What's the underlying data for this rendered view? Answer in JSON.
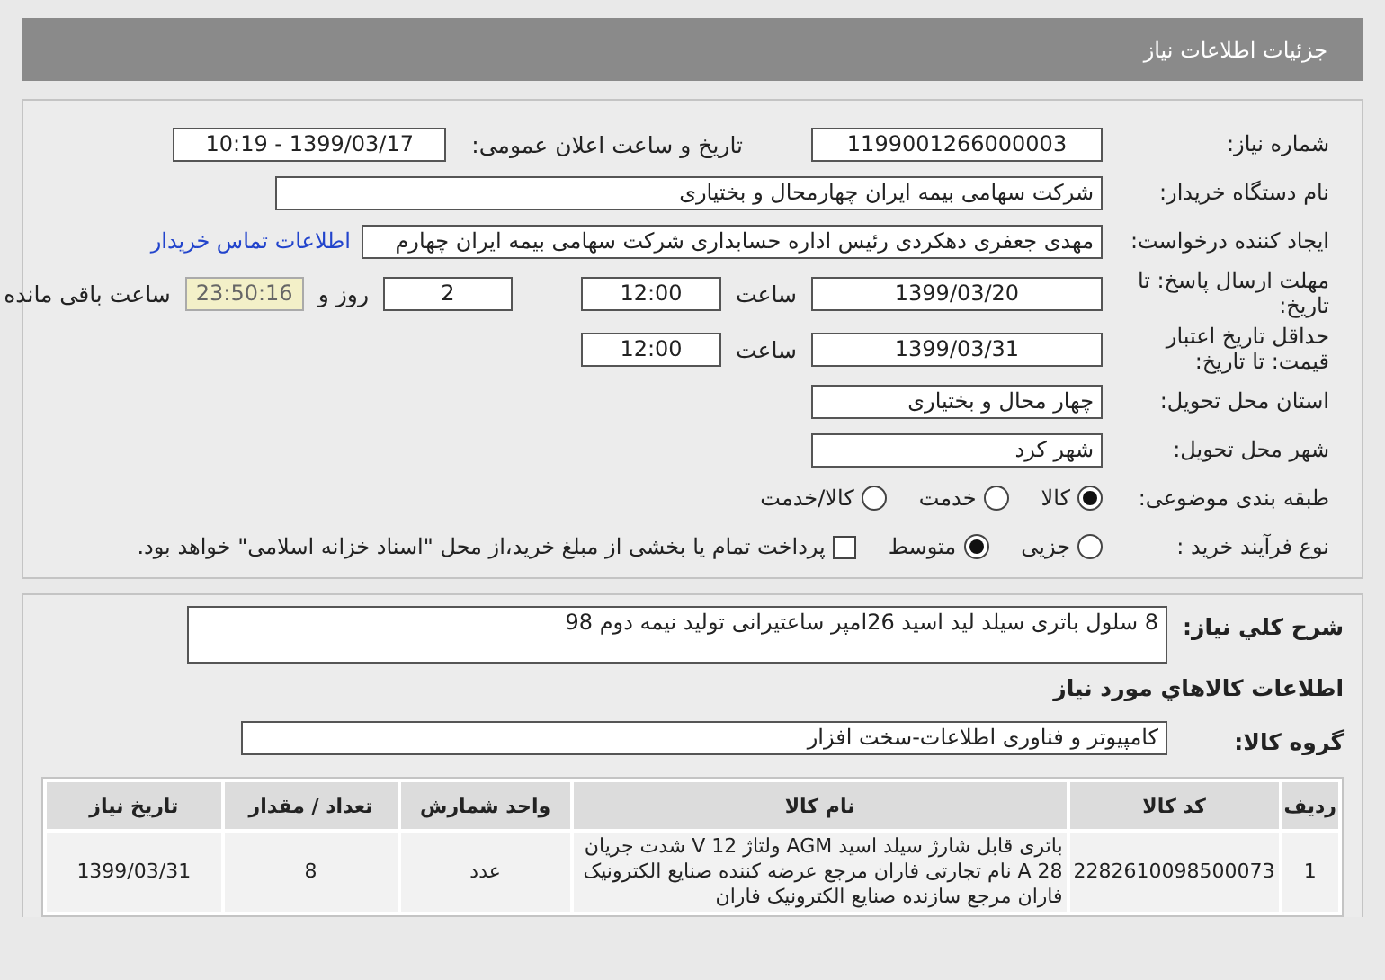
{
  "header": {
    "title": "جزئیات اطلاعات نیاز"
  },
  "need_number": {
    "label": "شماره نیاز:",
    "value": "1199001266000003"
  },
  "announce": {
    "label": "تاریخ و ساعت اعلان عمومی:",
    "value": "1399/03/17 - 10:19"
  },
  "buyer": {
    "label": "نام دستگاه خریدار:",
    "value": "شرکت سهامی بیمه ایران چهارمحال و بختیاری"
  },
  "creator": {
    "label": "ایجاد کننده درخواست:",
    "value": "مهدی جعفری دهکردی رئیس اداره حسابداری شرکت سهامی بیمه ایران چهارم",
    "link": "اطلاعات تماس خریدار"
  },
  "deadline": {
    "label": "مهلت ارسال پاسخ: تا تاریخ:",
    "date": "1399/03/20",
    "time_label": "ساعت",
    "time": "12:00",
    "days": "2",
    "days_label": "روز و",
    "remaining": "23:50:16",
    "remaining_label": "ساعت باقی مانده"
  },
  "validity": {
    "label": "حداقل تاریخ اعتبار قیمت: تا تاریخ:",
    "date": "1399/03/31",
    "time_label": "ساعت",
    "time": "12:00"
  },
  "province": {
    "label": "استان محل تحویل:",
    "value": "چهار محال و بختیاری"
  },
  "city": {
    "label": "شهر محل تحویل:",
    "value": "شهر کرد"
  },
  "category": {
    "label": "طبقه بندی موضوعی:",
    "options": [
      {
        "label": "کالا",
        "selected": true
      },
      {
        "label": "خدمت",
        "selected": false
      },
      {
        "label": "کالا/خدمت",
        "selected": false
      }
    ]
  },
  "process": {
    "label": "نوع فرآیند خرید :",
    "options": [
      {
        "label": "جزیی",
        "selected": false
      },
      {
        "label": "متوسط",
        "selected": true
      }
    ],
    "payment": {
      "label": "پرداخت تمام یا بخشی از مبلغ خرید،از محل \"اسناد خزانه اسلامی\" خواهد بود.",
      "checked": false
    }
  },
  "description": {
    "label": "شرح کلي نياز:",
    "value": "8 سلول باتری سیلد لید اسید 26امپر ساعتیرانی تولید نیمه دوم 98"
  },
  "goods_heading": "اطلاعات کالاهاي مورد نياز",
  "goods_group": {
    "label": "گروه کالا:",
    "value": "کامپیوتر و فناوری اطلاعات-سخت افزار"
  },
  "table": {
    "columns": [
      "ردیف",
      "کد کالا",
      "نام کالا",
      "واحد شمارش",
      "تعداد / مقدار",
      "تاریخ نیاز"
    ],
    "rows": [
      [
        "1",
        "2282610098500073",
        "باتری قابل شارژ سیلد اسید AGM ولتاژ 12 V شدت جریان 28 A نام تجارتی فاران مرجع عرضه کننده صنایع الکترونیک فاران مرجع سازنده صنایع الکترونیک فاران",
        "عدد",
        "8",
        "1399/03/31"
      ]
    ]
  }
}
